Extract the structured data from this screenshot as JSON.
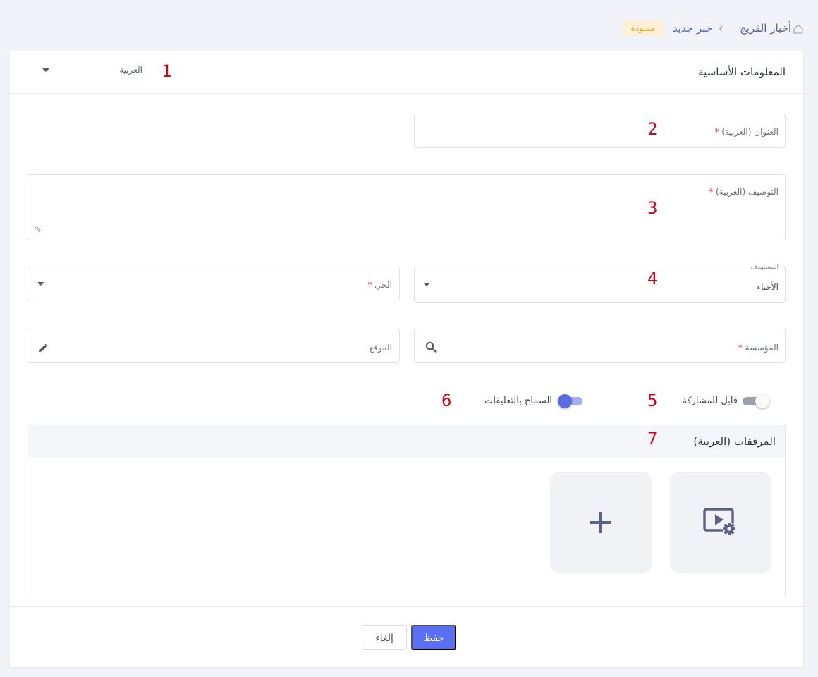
{
  "breadcrumb": {
    "home_icon": "home-icon",
    "items": [
      "أخبار الفريج",
      "خبر جديد"
    ],
    "separator": "‹",
    "status_badge": "مسودة"
  },
  "section": {
    "title": "المعلومات الأساسية",
    "language_select": {
      "value": "العربية"
    }
  },
  "form": {
    "title_field": {
      "label": "العنوان (العربية)",
      "required_mark": "*"
    },
    "description_field": {
      "label": "التوصيف (العربية)",
      "required_mark": "*"
    },
    "beneficiary_field": {
      "label": "المستهدف",
      "value": "الأحياء"
    },
    "district_field": {
      "label": "الحي",
      "required_mark": "*"
    },
    "institution_field": {
      "label": "المؤسسة",
      "required_mark": "*"
    },
    "location_field": {
      "label": "الموقع"
    },
    "shareable_toggle": {
      "label": "قابل للمشاركة",
      "on": false
    },
    "comments_toggle": {
      "label": "السماح بالتعليقات",
      "on": true
    }
  },
  "attachments": {
    "title": "المرفقات (العربية)",
    "tiles": [
      "video-settings-icon",
      "plus-icon"
    ]
  },
  "actions": {
    "save_label": "حفظ",
    "cancel_label": "إلغاء"
  },
  "annotations": [
    "1",
    "2",
    "3",
    "4",
    "5",
    "6",
    "7"
  ],
  "colors": {
    "primary": "#5b6ff5",
    "breadcrumb_link": "#5868c9",
    "badge_bg": "#fdf1d5",
    "badge_text": "#e8a533",
    "required": "#e23a3a",
    "annotation": "#d9001b",
    "toggle_on": "#5b6ee1"
  }
}
